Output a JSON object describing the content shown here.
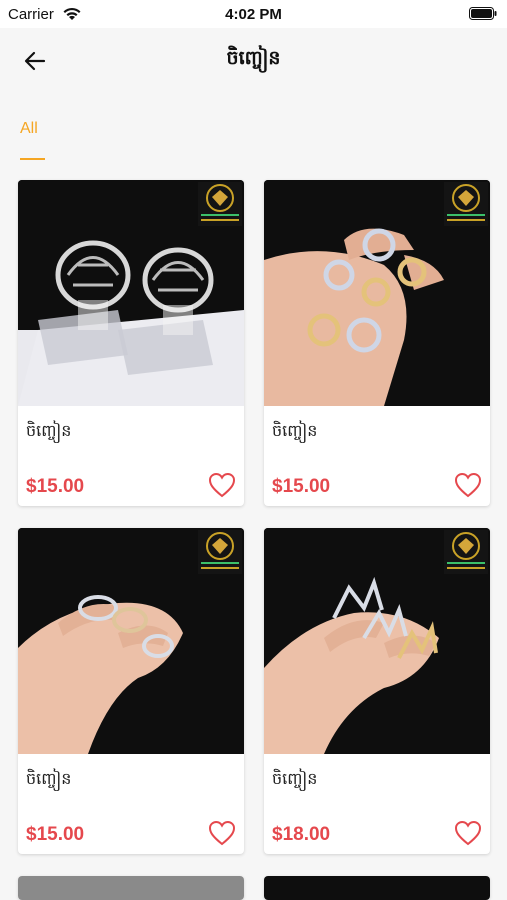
{
  "status_bar": {
    "carrier": "Carrier",
    "time": "4:02 PM"
  },
  "header": {
    "title": "ចិញ្ចៀន",
    "back_icon": "arrow-left-icon"
  },
  "tabs": [
    {
      "label": "All",
      "active": true,
      "color": "#f5a623"
    }
  ],
  "products": [
    {
      "name": "ចិញ្ចៀន",
      "price": "$15.00",
      "image": "two-silver-leaf-rings-on-display"
    },
    {
      "name": "ចិញ្ចៀន",
      "price": "$15.00",
      "image": "hand-with-crystal-rings"
    },
    {
      "name": "ចិញ្ចៀន",
      "price": "$15.00",
      "image": "hand-with-silver-knot-rings"
    },
    {
      "name": "ចិញ្ចៀន",
      "price": "$18.00",
      "image": "hand-with-leaf-rings"
    }
  ],
  "colors": {
    "price": "#e5484d",
    "accent": "#f5a623",
    "background": "#f6f6f6"
  }
}
